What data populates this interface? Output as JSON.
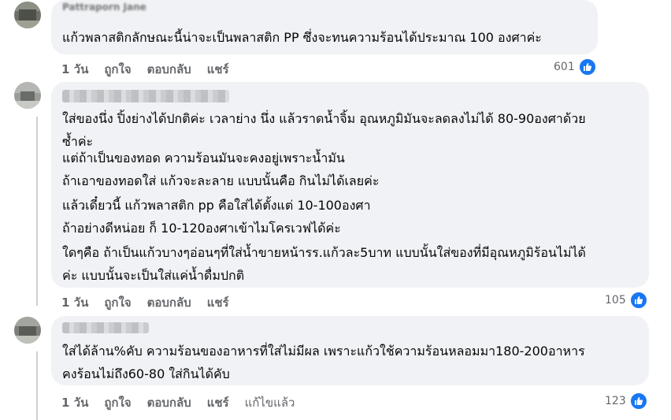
{
  "comments": [
    {
      "author": "Pattraporn Jane",
      "lines": [
        "แก้วพลาสติกลักษณะนี้น่าจะเป็นพลาสติก PP ซึ่งจะทนความร้อนได้ประมาณ 100 องศาค่ะ"
      ],
      "time": "1 วัน",
      "like": "ถูกใจ",
      "reply": "ตอบกลับ",
      "share": "แชร์",
      "count": "601"
    },
    {
      "author": "",
      "paragraphs": [
        [
          "ใส่ของนึ่ง ปิ้งย่างได้ปกติค่ะ เวลาย่าง นึ่ง แล้วราดน้ำจิ้ม อุณหภูมิมันจะลดลงไม่ได้ 80-90องศาด้วยซ้ำค่ะ",
          "ซ้ำค่ะ"
        ],
        [
          "แต่ถ้าเป็นของทอด ความร้อนมันจะคงอยู่เพราะน้ำมัน",
          "ถ้าเอาของทอดใส่ แก้วจะละลาย แบบนั้นคือ กินไม่ได้เลยค่ะ"
        ],
        [
          "แล้วเดี๋ยวนี้ แก้วพลาสติก pp คือใส่ได้ตั้งแต่ 10-100องศา",
          "ถ้าอย่างดีหน่อย ก็ 10-120องศาเข้าไมโครเวฟได้ค่ะ"
        ],
        [
          "ใดๆคือ ถ้าเป็นแก้วบางๆอ่อนๆที่ใส่น้ำขายหน้ารร.แก้วละ5บาท แบบนั้นใส่ของที่มีอุณหภูมิร้อนไม่ได้",
          "ค่ะ แบบนั้นจะเป็นใส่แค่น้ำดื่มปกติ"
        ]
      ],
      "time": "1 วัน",
      "like": "ถูกใจ",
      "reply": "ตอบกลับ",
      "share": "แชร์",
      "count": "105"
    },
    {
      "author": "",
      "lines": [
        "ใส่ได้ล้าน%คับ ความร้อนของอาหารที่ใส่ไม่มีผล เพราะแก้วใช้ความร้อนหลอมมา180-200อาหาร",
        "คงร้อนไม่ถึง60-80 ใส่กินได้คับ"
      ],
      "time": "1 วัน",
      "like": "ถูกใจ",
      "reply": "ตอบกลับ",
      "share": "แชร์",
      "edited": "แก้ไขแล้ว",
      "count": "123"
    }
  ],
  "colors": {
    "bubble": "#f0f2f5",
    "text": "#050505",
    "meta": "#65676b",
    "like": "#1877f2"
  }
}
